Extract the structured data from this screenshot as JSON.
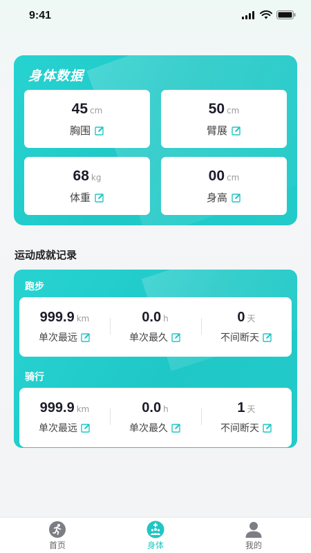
{
  "status_bar": {
    "time": "9:41"
  },
  "body_data": {
    "title": "身体数据",
    "metrics": [
      {
        "value": "45",
        "unit": "cm",
        "label": "胸围"
      },
      {
        "value": "50",
        "unit": "cm",
        "label": "臂展"
      },
      {
        "value": "68",
        "unit": "kg",
        "label": "体重"
      },
      {
        "value": "00",
        "unit": "cm",
        "label": "身高"
      }
    ]
  },
  "achievements": {
    "heading": "运动成就记录",
    "categories": [
      {
        "title": "跑步",
        "stats": [
          {
            "value": "999.9",
            "unit": "km",
            "label": "单次最远"
          },
          {
            "value": "0.0",
            "unit": "h",
            "label": "单次最久"
          },
          {
            "value": "0",
            "unit": "天",
            "label": "不间断天"
          }
        ]
      },
      {
        "title": "骑行",
        "stats": [
          {
            "value": "999.9",
            "unit": "km",
            "label": "单次最远"
          },
          {
            "value": "0.0",
            "unit": "h",
            "label": "单次最久"
          },
          {
            "value": "1",
            "unit": "天",
            "label": "不间断天"
          }
        ]
      }
    ]
  },
  "tab_bar": {
    "tabs": [
      {
        "label": "首页",
        "icon": "running-icon",
        "active": false
      },
      {
        "label": "身体",
        "icon": "body-icon",
        "active": true
      },
      {
        "label": "我的",
        "icon": "user-icon",
        "active": false
      }
    ]
  },
  "colors": {
    "accent": "#1fc6c4",
    "card_gradient_start": "#27d3d1",
    "text_dark": "#1c1c2a"
  }
}
